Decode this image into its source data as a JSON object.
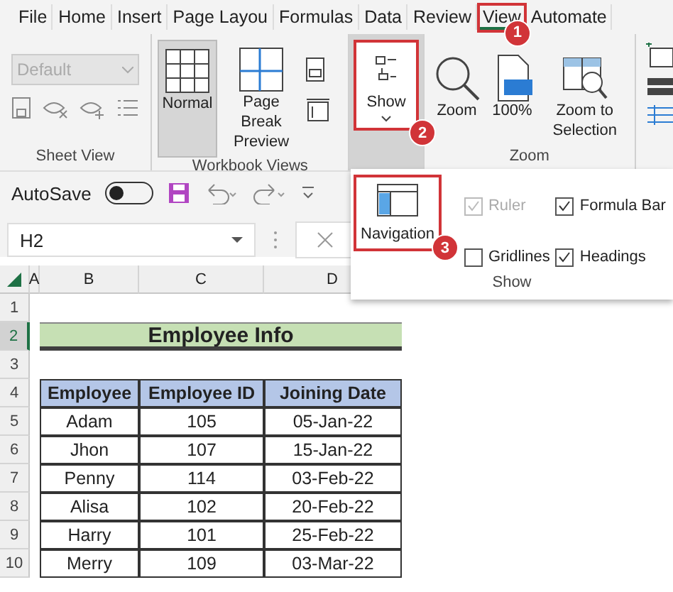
{
  "tabs": [
    {
      "label": "File",
      "selected": false
    },
    {
      "label": "Home",
      "selected": false
    },
    {
      "label": "Insert",
      "selected": false
    },
    {
      "label": "Page Layou",
      "selected": false
    },
    {
      "label": "Formulas",
      "selected": false
    },
    {
      "label": "Data",
      "selected": false
    },
    {
      "label": "Review",
      "selected": false
    },
    {
      "label": "View",
      "selected": true,
      "callout": "1"
    },
    {
      "label": "Automate",
      "selected": false
    }
  ],
  "ribbon": {
    "sheet_view": {
      "style_value": "Default",
      "label": "Sheet View"
    },
    "workbook_views": {
      "label": "Workbook Views",
      "buttons": [
        {
          "label": "Normal",
          "selected": true
        },
        {
          "label": "Page Break Preview",
          "selected": false
        }
      ]
    },
    "show_button": {
      "label": "Show",
      "callout": "2"
    },
    "zoom": {
      "label": "Zoom",
      "buttons": [
        {
          "label": "Zoom",
          "kind": "zoom"
        },
        {
          "label": "100%",
          "kind": "hundred"
        },
        {
          "label": "Zoom to Selection",
          "kind": "selection"
        }
      ]
    }
  },
  "quick_access": {
    "autosave_label": "AutoSave",
    "autosave_on": false
  },
  "show_panel": {
    "navigation": {
      "label": "Navigation",
      "callout": "3"
    },
    "label": "Show",
    "options": [
      {
        "label": "Ruler",
        "checked": true,
        "disabled": true
      },
      {
        "label": "Formula Bar",
        "checked": true,
        "disabled": false
      },
      {
        "label": "Gridlines",
        "checked": false,
        "disabled": false
      },
      {
        "label": "Headings",
        "checked": true,
        "disabled": false
      }
    ]
  },
  "name_box": "H2",
  "columns": [
    "A",
    "B",
    "C",
    "D"
  ],
  "rows": [
    {
      "label": "1",
      "selected": false
    },
    {
      "label": "2",
      "selected": true
    },
    {
      "label": "3",
      "selected": false
    },
    {
      "label": "4",
      "selected": false
    },
    {
      "label": "5",
      "selected": false
    },
    {
      "label": "6",
      "selected": false
    },
    {
      "label": "7",
      "selected": false
    },
    {
      "label": "8",
      "selected": false
    },
    {
      "label": "9",
      "selected": false
    },
    {
      "label": "10",
      "selected": false
    }
  ],
  "sheet": {
    "title": "Employee Info",
    "headers": [
      "Employee",
      "Employee ID",
      "Joining Date"
    ],
    "records": [
      [
        "Adam",
        "105",
        "05-Jan-22"
      ],
      [
        "Jhon",
        "107",
        "15-Jan-22"
      ],
      [
        "Penny",
        "114",
        "03-Feb-22"
      ],
      [
        "Alisa",
        "102",
        "20-Feb-22"
      ],
      [
        "Harry",
        "101",
        "25-Feb-22"
      ],
      [
        "Merry",
        "109",
        "03-Mar-22"
      ]
    ]
  }
}
